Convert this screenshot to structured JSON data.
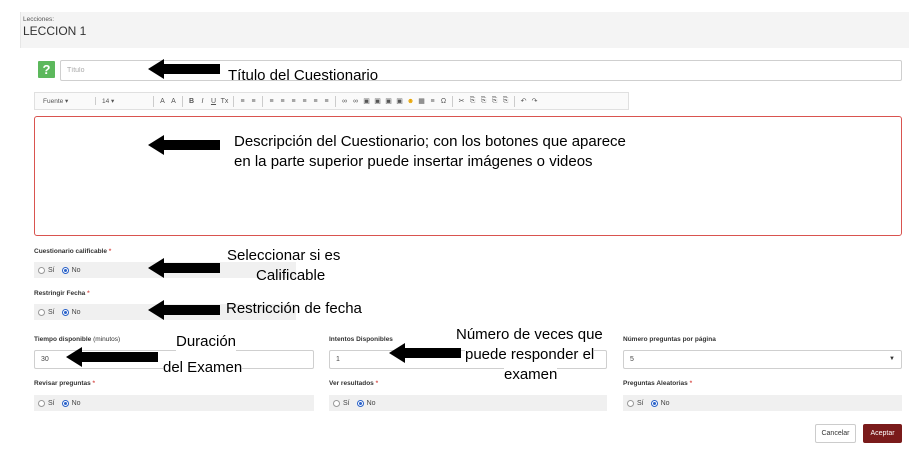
{
  "lesson": {
    "small_label": "Lecciones:",
    "title": "LECCION 1"
  },
  "quiz_icon": "?",
  "title_input": {
    "placeholder": "Título"
  },
  "toolbar": {
    "font_label": "Fuente",
    "size_label": "14",
    "buttons": [
      "A",
      "A",
      "B",
      "I",
      "U",
      "Tx",
      "≡",
      "≡",
      "≡",
      "≡",
      "≡",
      "≡",
      "≡",
      "≡",
      "∞",
      "∞",
      "▣",
      "▣",
      "▣",
      "▣",
      "☻",
      "▦",
      "≡",
      "Ω",
      "✂",
      "⎘",
      "⎘",
      "⎘",
      "⎘",
      "↶",
      "↷"
    ]
  },
  "form": {
    "calificable": {
      "label": "Cuestionario calificable",
      "required": "*",
      "opt_si": "Sí",
      "opt_no": "No",
      "selected": "No"
    },
    "restringir": {
      "label": "Restringir Fecha",
      "required": "*",
      "opt_si": "Sí",
      "opt_no": "No",
      "selected": "No"
    },
    "tiempo": {
      "label": "Tiempo disponible",
      "units": "(minutos)",
      "value": "30"
    },
    "intentos": {
      "label": "Intentos Disponibles",
      "value": "1"
    },
    "num_preguntas": {
      "label": "Número preguntas por página",
      "value": "5"
    },
    "revisar": {
      "label": "Revisar preguntas",
      "required": "*",
      "opt_si": "Sí",
      "opt_no": "No",
      "selected": "No"
    },
    "ver_resultados": {
      "label": "Ver resultados",
      "required": "*",
      "opt_si": "Sí",
      "opt_no": "No",
      "selected": "No"
    },
    "aleatorias": {
      "label": "Preguntas Aleatorias",
      "required": "*",
      "opt_si": "Sí",
      "opt_no": "No",
      "selected": "No"
    }
  },
  "buttons": {
    "cancel": "Cancelar",
    "accept": "Aceptar"
  },
  "annotations": {
    "titulo": "Título del Cuestionario",
    "descripcion_1": "Descripción del Cuestionario; con los botones que aparece",
    "descripcion_2": "en la parte superior puede insertar imágenes o videos",
    "calificable_1": "Seleccionar si es",
    "calificable_2": "Calificable",
    "restriccion": "Restricción de fecha",
    "duracion_1": "Duración",
    "duracion_2": "del Examen",
    "veces_1": "Número de veces que",
    "veces_2": "puede responder el",
    "veces_3": "examen"
  }
}
